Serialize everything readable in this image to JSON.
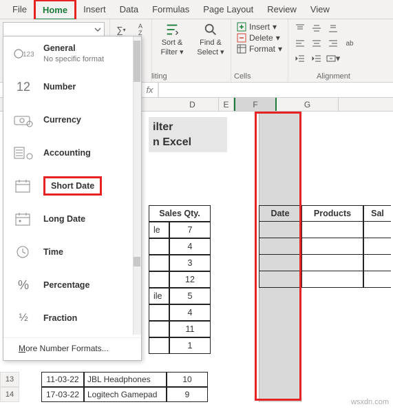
{
  "tabs": [
    "File",
    "Home",
    "Insert",
    "Data",
    "Formulas",
    "Page Layout",
    "Review",
    "View"
  ],
  "active_tab": "Home",
  "ribbon": {
    "number_format_selected": "",
    "editing": {
      "sort": "Sort &",
      "filter": "Filter ▾",
      "find": "Find &",
      "select": "Select ▾"
    },
    "editing_label": "liting",
    "cells": {
      "insert": "Insert",
      "delete": "Delete",
      "format": "Format",
      "label": "Cells"
    },
    "alignment": {
      "wrap": "ab",
      "label": "Alignment"
    }
  },
  "number_formats": [
    {
      "key": "general",
      "label": "General",
      "sub": "No specific format",
      "icon": "123"
    },
    {
      "key": "number",
      "label": "Number",
      "icon": "12"
    },
    {
      "key": "currency",
      "label": "Currency",
      "icon": "cash"
    },
    {
      "key": "accounting",
      "label": "Accounting",
      "icon": "ledger"
    },
    {
      "key": "shortdate",
      "label": "Short Date",
      "icon": "cal"
    },
    {
      "key": "longdate",
      "label": "Long Date",
      "icon": "cal-dot"
    },
    {
      "key": "time",
      "label": "Time",
      "icon": "clock"
    },
    {
      "key": "percentage",
      "label": "Percentage",
      "icon": "pct"
    },
    {
      "key": "fraction",
      "label": "Fraction",
      "icon": "frac"
    }
  ],
  "number_formats_more": "More Number Formats...",
  "title_lines": [
    "ilter",
    "n Excel"
  ],
  "col_headers": [
    "D",
    "E",
    "F",
    "G"
  ],
  "formula_bar_fx": "fx",
  "left_table": {
    "header": "Sales Qty.",
    "rows": [
      {
        "b": "le",
        "c": "7"
      },
      {
        "b": "",
        "c": "4"
      },
      {
        "b": "",
        "c": "3"
      },
      {
        "b": "",
        "c": "12"
      },
      {
        "b": "ile",
        "c": "5"
      },
      {
        "b": "",
        "c": "4"
      },
      {
        "b": "",
        "c": "11"
      },
      {
        "b": "",
        "c": "1"
      }
    ]
  },
  "bottom_rows": [
    {
      "n": "13",
      "a": "11-03-22",
      "b": "JBL Headphones",
      "c": "10"
    },
    {
      "n": "14",
      "a": "17-03-22",
      "b": "Logitech Gamepad",
      "c": "9"
    }
  ],
  "right_table": {
    "headers": [
      "Date",
      "Products",
      "Sal"
    ],
    "row_count": 4
  },
  "watermark": "wsxdn.com"
}
